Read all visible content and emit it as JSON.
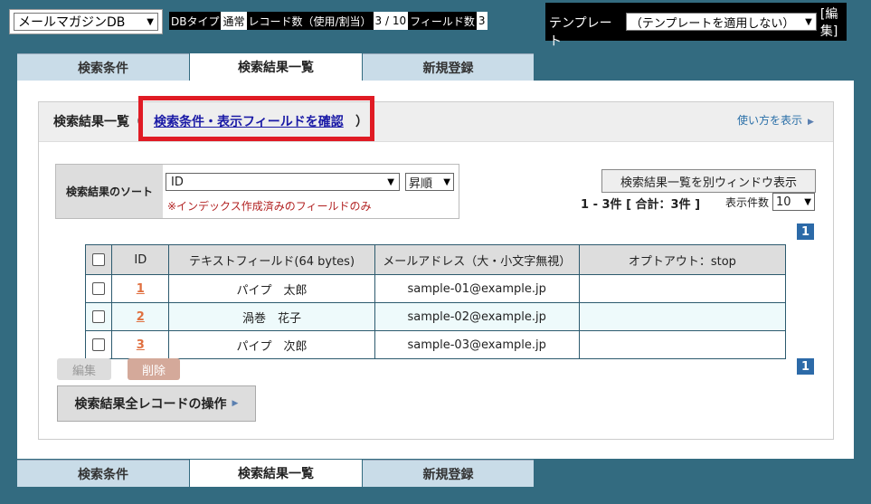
{
  "topbar": {
    "db_select": "メールマガジンDB",
    "db_type_label": "DBタイプ",
    "db_type_value": "通常",
    "record_count_label": "レコード数（使用/割当）",
    "record_count_value": "3 / 10",
    "field_count_label": "フィールド数",
    "field_count_value": "3",
    "template_label": "テンプレート",
    "template_select": "（テンプレートを適用しない）",
    "edit_link": "[編集]"
  },
  "tabs": [
    {
      "label": "検索条件",
      "active": false
    },
    {
      "label": "検索結果一覧",
      "active": true
    },
    {
      "label": "新規登録",
      "active": false
    }
  ],
  "header": {
    "title": "検索結果一覧",
    "open_paren": "（",
    "link": "検索条件・表示フィールドを確認",
    "close_paren": "）",
    "usage_link": "使い方を表示"
  },
  "sort": {
    "label": "検索結果のソート",
    "field": "ID",
    "order": "昇順",
    "note": "※インデックス作成済みのフィールドのみ"
  },
  "controls": {
    "open_window_button": "検索結果一覧を別ウィンドウ表示",
    "count_text": "1 - 3件 [ 合計：3件 ]",
    "per_page_label": "表示件数",
    "per_page_value": "10",
    "page_number": "1"
  },
  "table": {
    "headers": [
      "ID",
      "テキストフィールド(64 bytes)",
      "メールアドレス（大・小文字無視）",
      "オプトアウト：stop"
    ],
    "rows": [
      {
        "id": "1",
        "text": "パイプ　太郎",
        "email": "sample-01@example.jp",
        "optout": ""
      },
      {
        "id": "2",
        "text": "渦巻　花子",
        "email": "sample-02@example.jp",
        "optout": ""
      },
      {
        "id": "3",
        "text": "パイプ　次郎",
        "email": "sample-03@example.jp",
        "optout": ""
      }
    ]
  },
  "actions": {
    "edit_button": "編集",
    "delete_button": "削除",
    "all_records_button": "検索結果全レコードの操作"
  },
  "colors": {
    "background": "#336b80",
    "highlight_box": "#e01b24",
    "link": "#1a1aa6",
    "page_badge": "#2c6aa8"
  }
}
